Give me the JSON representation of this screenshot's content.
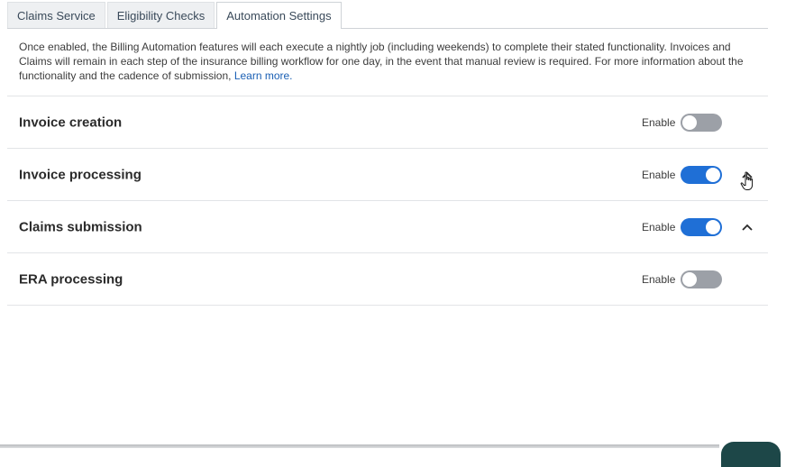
{
  "tabs": [
    {
      "label": "Claims Service",
      "active": false
    },
    {
      "label": "Eligibility Checks",
      "active": false
    },
    {
      "label": "Automation Settings",
      "active": true
    }
  ],
  "description": {
    "text": "Once enabled, the Billing Automation features will each execute a nightly job (including weekends) to complete their stated functionality. Invoices and Claims will remain in each step of the insurance billing workflow for one day, in the event that manual review is required. For more information about the functionality and the cadence of submission, ",
    "link_label": "Learn more."
  },
  "settings": [
    {
      "title": "Invoice creation",
      "enable_label": "Enable",
      "enabled": false
    },
    {
      "title": "Invoice processing",
      "enable_label": "Enable",
      "enabled": true
    },
    {
      "title": "Claims submission",
      "enable_label": "Enable",
      "enabled": true
    },
    {
      "title": "ERA processing",
      "enable_label": "Enable",
      "enabled": false
    }
  ],
  "colors": {
    "toggle_on": "#1f6fd6",
    "toggle_off": "#9ca0a7",
    "link": "#1a5fb4"
  }
}
